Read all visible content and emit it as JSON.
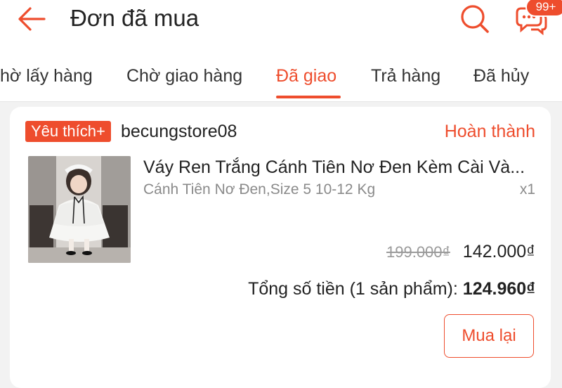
{
  "header": {
    "title": "Đơn đã mua",
    "back_icon": "arrow-left-icon",
    "search_icon": "search-icon",
    "chat_icon": "chat-icon",
    "chat_badge": "99+",
    "accent_color": "#ee4d2d"
  },
  "tabs": [
    {
      "label": "hờ lấy hàng",
      "active": false
    },
    {
      "label": "Chờ giao hàng",
      "active": false
    },
    {
      "label": "Đã giao",
      "active": true
    },
    {
      "label": "Trả hàng",
      "active": false
    },
    {
      "label": "Đã hủy",
      "active": false
    }
  ],
  "order": {
    "shop_tag": "Yêu thích+",
    "shop_name": "becungstore08",
    "status": "Hoàn thành",
    "product": {
      "name": "Váy Ren Trắng Cánh Tiên Nơ Đen Kèm Cài Và...",
      "variant": "Cánh Tiên Nơ Đen,Size 5 10-12 Kg",
      "quantity": "x1",
      "original_price": "199.000₫",
      "price": "142.000₫"
    },
    "total_label": "Tổng số tiền (1 sản phẩm):",
    "total_value": "124.960₫",
    "rebuy_label": "Mua lại"
  }
}
